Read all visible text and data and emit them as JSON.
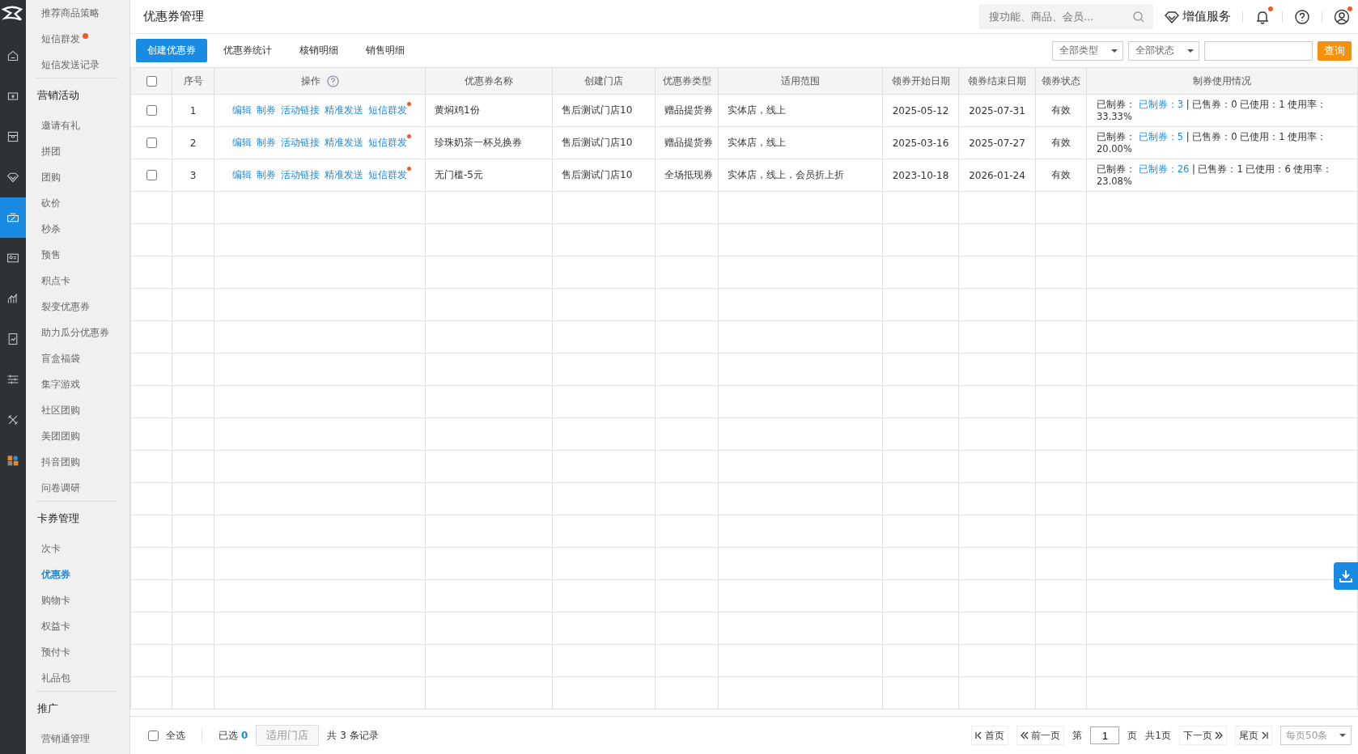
{
  "rail": [
    {
      "selected": false
    },
    {
      "selected": false
    },
    {
      "selected": false
    },
    {
      "selected": false
    },
    {
      "selected": true
    },
    {
      "selected": false
    },
    {
      "selected": false
    },
    {
      "selected": false
    },
    {
      "selected": false
    },
    {
      "selected": false
    },
    {
      "selected": false
    }
  ],
  "sidebar": [
    {
      "kind": "item",
      "label": "推荐商品策略",
      "selected": false,
      "dot": false
    },
    {
      "kind": "item",
      "label": "短信群发",
      "selected": false,
      "dot": true
    },
    {
      "kind": "item",
      "label": "短信发送记录",
      "selected": false,
      "dot": false
    },
    {
      "kind": "heading",
      "label": "营销活动"
    },
    {
      "kind": "item",
      "label": "邀请有礼",
      "selected": false,
      "dot": false
    },
    {
      "kind": "item",
      "label": "拼团",
      "selected": false,
      "dot": false
    },
    {
      "kind": "item",
      "label": "团购",
      "selected": false,
      "dot": false
    },
    {
      "kind": "item",
      "label": "砍价",
      "selected": false,
      "dot": false
    },
    {
      "kind": "item",
      "label": "秒杀",
      "selected": false,
      "dot": false
    },
    {
      "kind": "item",
      "label": "预售",
      "selected": false,
      "dot": false
    },
    {
      "kind": "item",
      "label": "积点卡",
      "selected": false,
      "dot": false
    },
    {
      "kind": "item",
      "label": "裂变优惠券",
      "selected": false,
      "dot": false
    },
    {
      "kind": "item",
      "label": "助力瓜分优惠券",
      "selected": false,
      "dot": false
    },
    {
      "kind": "item",
      "label": "盲盒福袋",
      "selected": false,
      "dot": false
    },
    {
      "kind": "item",
      "label": "集字游戏",
      "selected": false,
      "dot": false
    },
    {
      "kind": "item",
      "label": "社区团购",
      "selected": false,
      "dot": false
    },
    {
      "kind": "item",
      "label": "美团团购",
      "selected": false,
      "dot": false
    },
    {
      "kind": "item",
      "label": "抖音团购",
      "selected": false,
      "dot": false
    },
    {
      "kind": "item",
      "label": "问卷调研",
      "selected": false,
      "dot": false
    },
    {
      "kind": "heading",
      "label": "卡券管理"
    },
    {
      "kind": "item",
      "label": "次卡",
      "selected": false,
      "dot": false
    },
    {
      "kind": "item",
      "label": "优惠券",
      "selected": true,
      "dot": false
    },
    {
      "kind": "item",
      "label": "购物卡",
      "selected": false,
      "dot": false
    },
    {
      "kind": "item",
      "label": "权益卡",
      "selected": false,
      "dot": false
    },
    {
      "kind": "item",
      "label": "预付卡",
      "selected": false,
      "dot": false
    },
    {
      "kind": "item",
      "label": "礼品包",
      "selected": false,
      "dot": false
    },
    {
      "kind": "heading",
      "label": "推广"
    },
    {
      "kind": "item",
      "label": "营销通管理",
      "selected": false,
      "dot": false
    }
  ],
  "page_title": "优惠券管理",
  "search": {
    "placeholder": "搜功能、商品、会员..."
  },
  "value_service": "增值服务",
  "notifications": {
    "dot": true
  },
  "account": {
    "dot": true
  },
  "tabs": [
    {
      "label": "创建优惠券",
      "selected": true
    },
    {
      "label": "优惠券统计",
      "selected": false
    },
    {
      "label": "核销明细",
      "selected": false
    },
    {
      "label": "销售明细",
      "selected": false
    }
  ],
  "filters": {
    "type": "全部类型",
    "status": "全部状态",
    "query_button": "查询"
  },
  "table": {
    "all_checked": false,
    "columns": [
      "序号",
      "操作",
      "优惠券名称",
      "创建门店",
      "优惠券类型",
      "适用范围",
      "领券开始日期",
      "领券结束日期",
      "领券状态",
      "制券使用情况"
    ],
    "rows": [
      {
        "checked": false,
        "no": "1",
        "actions": [
          {
            "label": "编辑",
            "dot": false
          },
          {
            "label": "制券",
            "dot": false
          },
          {
            "label": "活动链接",
            "dot": false
          },
          {
            "label": "精准发送",
            "dot": false
          },
          {
            "label": "短信群发",
            "dot": true
          }
        ],
        "name": "黄焖鸡1份",
        "store": "售后测试门店10",
        "type": "赠品提货券",
        "scope": "实体店，线上",
        "start": "2025-05-12",
        "end": "2025-07-31",
        "status": "有效",
        "usage": {
          "prefix": "已制券：",
          "link": "已制券：3",
          "rest": "| 已售券：0 已使用：1 使用率：33.33%"
        }
      },
      {
        "checked": false,
        "no": "2",
        "actions": [
          {
            "label": "编辑",
            "dot": false
          },
          {
            "label": "制券",
            "dot": false
          },
          {
            "label": "活动链接",
            "dot": false
          },
          {
            "label": "精准发送",
            "dot": false
          },
          {
            "label": "短信群发",
            "dot": true
          }
        ],
        "name": "珍珠奶茶一杯兑换券",
        "store": "售后测试门店10",
        "type": "赠品提货券",
        "scope": "实体店，线上",
        "start": "2025-03-16",
        "end": "2025-07-27",
        "status": "有效",
        "usage": {
          "prefix": "已制券：",
          "link": "已制券：5",
          "rest": "| 已售券：0 已使用：1 使用率：20.00%"
        }
      },
      {
        "checked": false,
        "no": "3",
        "actions": [
          {
            "label": "编辑",
            "dot": false
          },
          {
            "label": "制券",
            "dot": false
          },
          {
            "label": "活动链接",
            "dot": false
          },
          {
            "label": "精准发送",
            "dot": false
          },
          {
            "label": "短信群发",
            "dot": true
          }
        ],
        "name": "无门槛-5元",
        "store": "售后测试门店10",
        "type": "全场抵现券",
        "scope": "实体店，线上，会员折上折",
        "start": "2023-10-18",
        "end": "2026-01-24",
        "status": "有效",
        "usage": {
          "prefix": "已制券：",
          "link": "已制券：26",
          "rest": "| 已售券：1 已使用：6 使用率：23.08%"
        }
      }
    ]
  },
  "footer": {
    "select_all": {
      "label": "全选",
      "checked": false
    },
    "selected_label": "已选",
    "selected_count": "0",
    "store_button": "适用门店",
    "total": "共 3 条记录",
    "pager": {
      "first": "首页",
      "prev": "前一页",
      "page_prefix": "第",
      "page": "1",
      "page_suffix": "页",
      "pages": "共1页",
      "next": "下一页",
      "last": "尾页",
      "per_page": "每页50条"
    }
  }
}
